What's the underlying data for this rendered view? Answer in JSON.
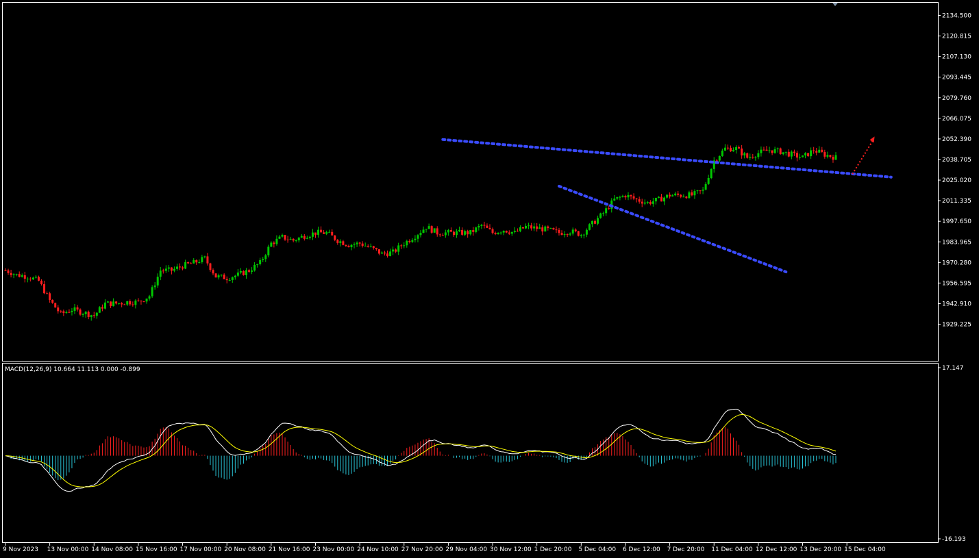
{
  "colors": {
    "background": "#000000",
    "frame": "#ffffff",
    "bull": "#00c800",
    "bear": "#ff1e1e",
    "trendline": "#3a4bff",
    "projection_arrow": "#ff2020",
    "macd_line": "#ffffff",
    "signal_line": "#ffff00",
    "hist_pos": "#ff2020",
    "hist_neg": "#29c6d8"
  },
  "indicator": {
    "label": "MACD(12,26,9) 10.664 11.113 0.000 -0.899"
  },
  "chart_data": {
    "type": "candlestick",
    "price_axis": {
      "ticks": [
        "2134.500",
        "2120.815",
        "2107.130",
        "2093.445",
        "2079.760",
        "2066.075",
        "2052.390",
        "2038.705",
        "2025.020",
        "2011.335",
        "1997.650",
        "1983.965",
        "1970.280",
        "1956.595",
        "1942.910",
        "1929.225"
      ],
      "range": [
        1919.0,
        2137.0
      ]
    },
    "macd_axis": {
      "ticks": [
        "17.147",
        "-16.193"
      ],
      "range": [
        -16.193,
        17.147
      ]
    },
    "time_axis": {
      "labels": [
        "9 Nov 2023",
        "13 Nov 00:00",
        "14 Nov 08:00",
        "15 Nov 16:00",
        "17 Nov 00:00",
        "20 Nov 08:00",
        "21 Nov 16:00",
        "23 Nov 00:00",
        "24 Nov 10:00",
        "27 Nov 20:00",
        "29 Nov 04:00",
        "30 Nov 12:00",
        "1 Dec 20:00",
        "5 Dec 04:00",
        "6 Dec 12:00",
        "7 Dec 20:00",
        "11 Dec 04:00",
        "12 Dec 12:00",
        "13 Dec 20:00",
        "15 Dec 04:00"
      ],
      "bars_per_label": 16,
      "first_label_bar": 0
    },
    "bars_visible": 301,
    "price_anchors": [
      [
        0,
        1965
      ],
      [
        4,
        1962
      ],
      [
        8,
        1961
      ],
      [
        12,
        1958
      ],
      [
        16,
        1945
      ],
      [
        20,
        1936
      ],
      [
        24,
        1939
      ],
      [
        28,
        1937
      ],
      [
        32,
        1935
      ],
      [
        36,
        1943
      ],
      [
        40,
        1943
      ],
      [
        44,
        1944
      ],
      [
        48,
        1944
      ],
      [
        52,
        1948
      ],
      [
        56,
        1965
      ],
      [
        60,
        1965
      ],
      [
        64,
        1968
      ],
      [
        68,
        1970
      ],
      [
        72,
        1973
      ],
      [
        76,
        1961
      ],
      [
        80,
        1960
      ],
      [
        84,
        1962
      ],
      [
        88,
        1965
      ],
      [
        92,
        1970
      ],
      [
        96,
        1983
      ],
      [
        100,
        1987
      ],
      [
        104,
        1985
      ],
      [
        108,
        1988
      ],
      [
        112,
        1990
      ],
      [
        116,
        1990
      ],
      [
        120,
        1985
      ],
      [
        124,
        1982
      ],
      [
        128,
        1983
      ],
      [
        132,
        1980
      ],
      [
        136,
        1976
      ],
      [
        140,
        1977
      ],
      [
        144,
        1983
      ],
      [
        148,
        1988
      ],
      [
        152,
        1994
      ],
      [
        156,
        1990
      ],
      [
        160,
        1990
      ],
      [
        164,
        1990
      ],
      [
        168,
        1990
      ],
      [
        172,
        1995
      ],
      [
        176,
        1990
      ],
      [
        180,
        1992
      ],
      [
        184,
        1990
      ],
      [
        188,
        1994
      ],
      [
        192,
        1993
      ],
      [
        196,
        1992
      ],
      [
        200,
        1990
      ],
      [
        204,
        1991
      ],
      [
        208,
        1989
      ],
      [
        212,
        1996
      ],
      [
        216,
        2003
      ],
      [
        220,
        2012
      ],
      [
        224,
        2015
      ],
      [
        228,
        2012
      ],
      [
        232,
        2010
      ],
      [
        236,
        2012
      ],
      [
        240,
        2015
      ],
      [
        244,
        2015
      ],
      [
        248,
        2015
      ],
      [
        252,
        2018
      ],
      [
        256,
        2038
      ],
      [
        260,
        2046
      ],
      [
        264,
        2046
      ],
      [
        268,
        2040
      ],
      [
        272,
        2043
      ],
      [
        276,
        2045
      ],
      [
        280,
        2044
      ],
      [
        284,
        2042
      ],
      [
        288,
        2040
      ],
      [
        292,
        2045
      ],
      [
        296,
        2042
      ],
      [
        300,
        2040
      ]
    ],
    "trendlines": [
      {
        "from": [
          158,
          2052
        ],
        "to": [
          320,
          2027
        ]
      },
      {
        "from": [
          200,
          2021
        ],
        "to": [
          282,
          1964
        ]
      }
    ],
    "projection": {
      "from": [
        306,
        2029
      ],
      "to": [
        314,
        2054
      ]
    }
  }
}
